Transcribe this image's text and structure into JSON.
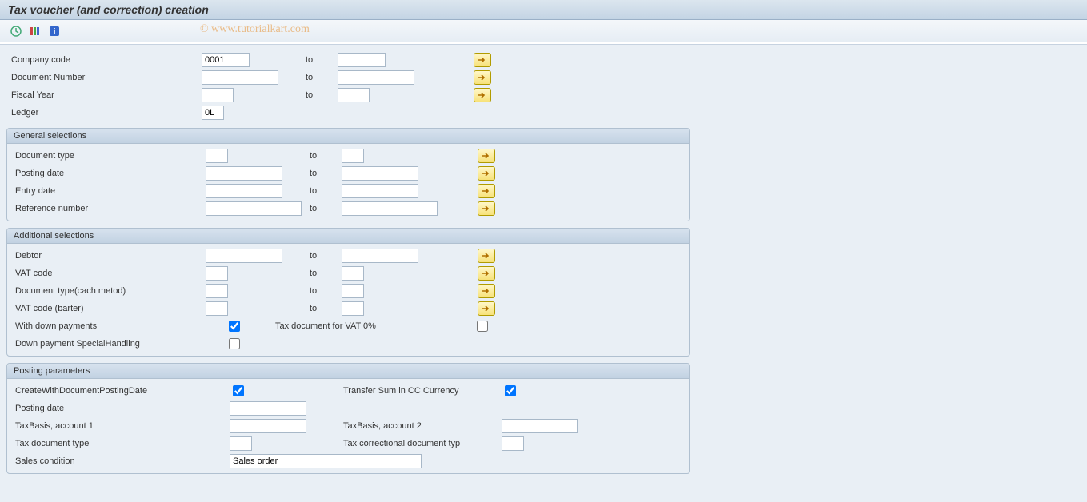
{
  "title": "Tax voucher (and correction) creation",
  "watermark": "© www.tutorialkart.com",
  "top": {
    "company_code": {
      "label": "Company code",
      "from": "0001",
      "to_label": "to",
      "to": ""
    },
    "document_number": {
      "label": "Document Number",
      "from": "",
      "to_label": "to",
      "to": ""
    },
    "fiscal_year": {
      "label": "Fiscal Year",
      "from": "",
      "to_label": "to",
      "to": ""
    },
    "ledger": {
      "label": "Ledger",
      "value": "0L"
    }
  },
  "general": {
    "title": "General selections",
    "document_type": {
      "label": "Document type",
      "from": "",
      "to_label": "to",
      "to": ""
    },
    "posting_date": {
      "label": "Posting date",
      "from": "",
      "to_label": "to",
      "to": ""
    },
    "entry_date": {
      "label": "Entry date",
      "from": "",
      "to_label": "to",
      "to": ""
    },
    "reference_number": {
      "label": "Reference number",
      "from": "",
      "to_label": "to",
      "to": ""
    }
  },
  "additional": {
    "title": "Additional selections",
    "debtor": {
      "label": "Debtor",
      "from": "",
      "to_label": "to",
      "to": ""
    },
    "vat_code": {
      "label": "VAT code",
      "from": "",
      "to_label": "to",
      "to": ""
    },
    "doc_type_cash": {
      "label": "Document type(cach metod)",
      "from": "",
      "to_label": "to",
      "to": ""
    },
    "vat_code_barter": {
      "label": "VAT code (barter)",
      "from": "",
      "to_label": "to",
      "to": ""
    },
    "with_down_payments": {
      "label": "With down payments",
      "checked": true
    },
    "tax_doc_vat0": {
      "label": "Tax document for VAT 0%",
      "checked": false
    },
    "down_payment_special": {
      "label": "Down payment SpecialHandling",
      "checked": false
    }
  },
  "posting": {
    "title": "Posting parameters",
    "create_with_doc_posting_date": {
      "label": "CreateWithDocumentPostingDate",
      "checked": true
    },
    "transfer_sum_cc": {
      "label": "Transfer Sum in CC Currency",
      "checked": true
    },
    "posting_date": {
      "label": "Posting date",
      "value": ""
    },
    "tax_basis_1": {
      "label": "TaxBasis, account 1",
      "value": ""
    },
    "tax_basis_2": {
      "label": "TaxBasis, account 2",
      "value": ""
    },
    "tax_doc_type": {
      "label": "Tax document type",
      "value": ""
    },
    "tax_corr_doc_type": {
      "label": "Tax correctional document  typ",
      "value": ""
    },
    "sales_condition": {
      "label": "Sales condition",
      "value": "Sales order"
    }
  }
}
